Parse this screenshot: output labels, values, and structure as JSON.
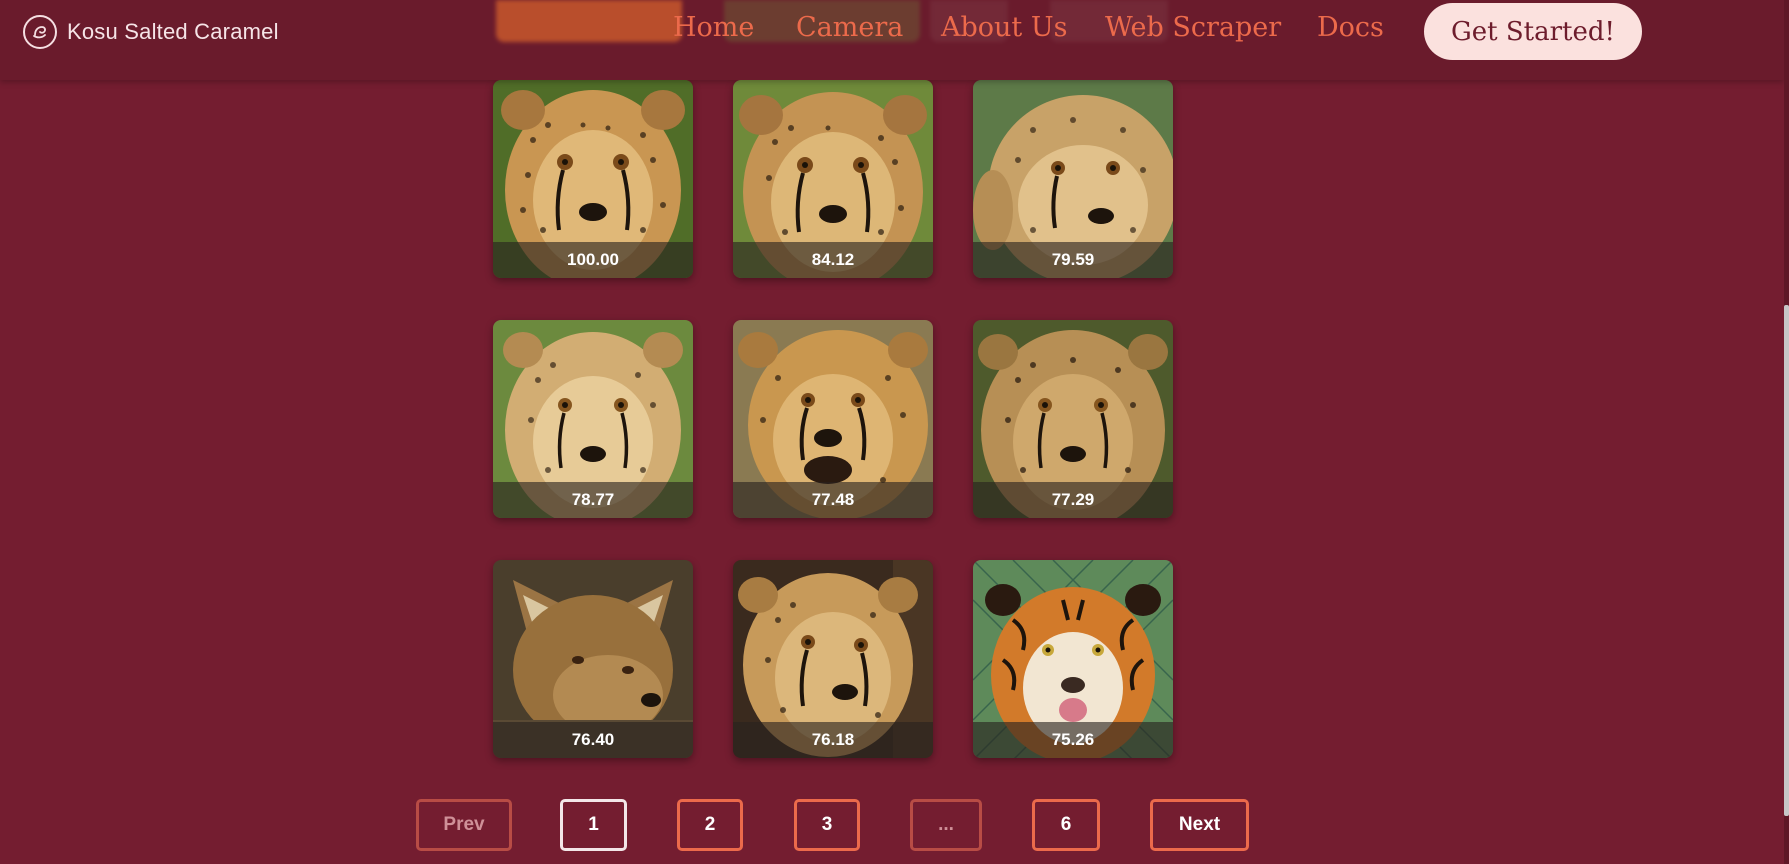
{
  "navbar": {
    "brand": "Kosu Salted Caramel",
    "links": [
      "Home",
      "Camera",
      "About Us",
      "Web Scraper",
      "Docs"
    ],
    "cta": "Get Started!"
  },
  "results": [
    {
      "score": "100.00",
      "animal": "cheetah"
    },
    {
      "score": "84.12",
      "animal": "cheetah"
    },
    {
      "score": "79.59",
      "animal": "cheetah"
    },
    {
      "score": "78.77",
      "animal": "cheetah"
    },
    {
      "score": "77.48",
      "animal": "cheetah"
    },
    {
      "score": "77.29",
      "animal": "cheetah"
    },
    {
      "score": "76.40",
      "animal": "fox"
    },
    {
      "score": "76.18",
      "animal": "cheetah"
    },
    {
      "score": "75.26",
      "animal": "tiger"
    }
  ],
  "pagination": {
    "prev": "Prev",
    "pages": [
      "1",
      "2",
      "3",
      "...",
      "6"
    ],
    "next": "Next",
    "current": "1"
  },
  "colors": {
    "background": "#741d30",
    "navbar": "#6a1b2c",
    "accent": "#ec6a4b",
    "cta_bg": "#fbe1de"
  }
}
